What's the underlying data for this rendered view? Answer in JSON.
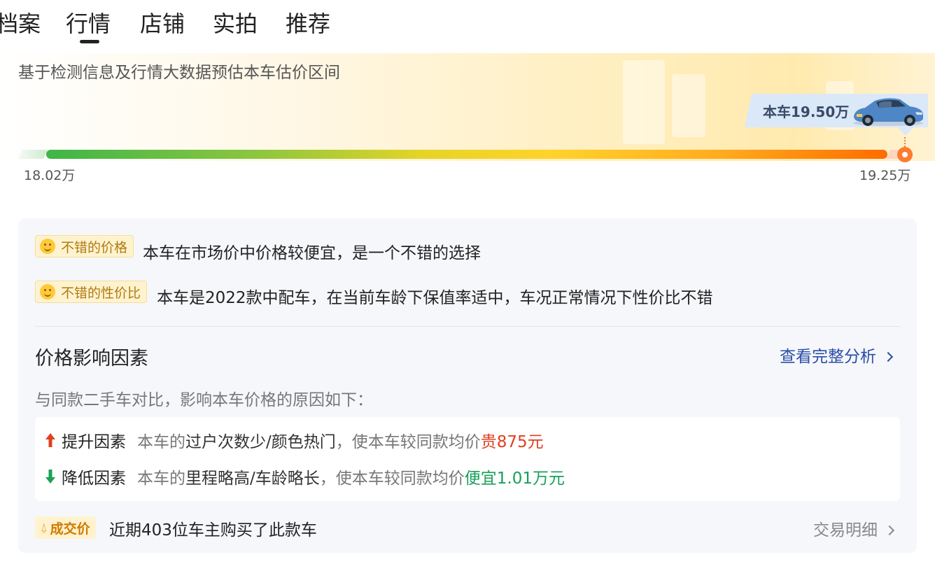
{
  "tabs": [
    {
      "label": "档案",
      "active": false
    },
    {
      "label": "行情",
      "active": true
    },
    {
      "label": "店铺",
      "active": false
    },
    {
      "label": "实拍",
      "active": false
    },
    {
      "label": "推荐",
      "active": false
    }
  ],
  "estimate": {
    "subtitle": "基于检测信息及行情大数据预估本车估价区间",
    "current_price_label": "本车19.50万",
    "range_min": "18.02万",
    "range_max": "19.25万",
    "gradient_colors": [
      "#3fb549",
      "#e6d427",
      "#ffd32a",
      "#ff6c00"
    ],
    "marker_color": "#ff7a2e"
  },
  "analysis": {
    "tags": [
      {
        "label": "不错的价格",
        "desc": "本车在市场价中价格较便宜，是一个不错的选择",
        "icon": "smile-icon"
      },
      {
        "label": "不错的性价比",
        "desc": "本车是2022款中配车，在当前车龄下保值率适中，车况正常情况下性价比不错",
        "icon": "smile-icon"
      }
    ],
    "factors": {
      "title": "价格影响因素",
      "link_label": "查看完整分析",
      "subtitle": "与同款二手车对比，影响本车价格的原因如下：",
      "rows": [
        {
          "type": "up",
          "label": "提升因素",
          "prefix": "本车的",
          "reason": "过户次数少/颜色热门",
          "middle": "，使本车较同款均价",
          "value": "贵875元",
          "color": "#e04020"
        },
        {
          "type": "down",
          "label": "降低因素",
          "prefix": "本车的",
          "reason": "里程略高/车龄略长",
          "middle": "，使本车较同款均价",
          "value": "便宜1.01万元",
          "color": "#1aa05a"
        }
      ]
    },
    "deal": {
      "tag_label": "成交价",
      "desc": "近期403位车主购买了此款车",
      "detail_label": "交易明细"
    }
  }
}
